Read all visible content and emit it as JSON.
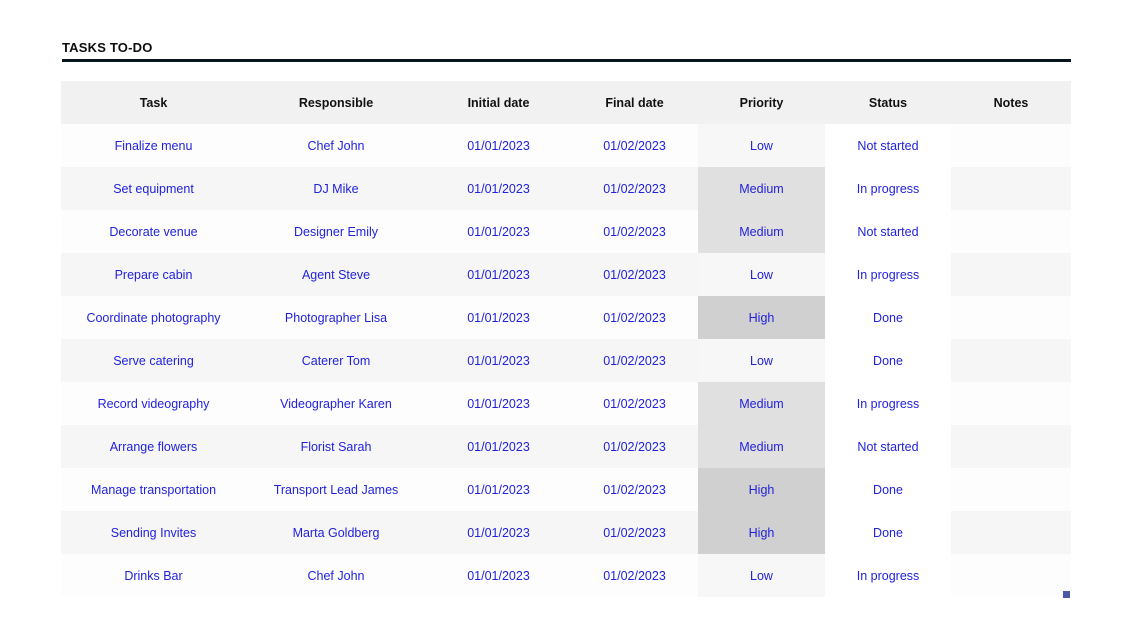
{
  "header": {
    "title": "TASKS TO-DO"
  },
  "colors": {
    "title_text": "#0d0d0d",
    "rule": "#07161d",
    "cell_text": "#2222dd",
    "header_bg": "#f1f1f1",
    "row_odd_bg": "#fdfdfd",
    "row_even_bg": "#f6f6f6",
    "priority_low_bg": "#f7f7f7",
    "priority_medium_bg": "#e0e0e0",
    "priority_high_bg": "#d0d0d0",
    "status_bg": "#ffffff",
    "status_border": "#e3e3e3",
    "resize_handle": "#4a5aa8"
  },
  "table": {
    "columns": [
      "Task",
      "Responsible",
      "Initial date",
      "Final date",
      "Priority",
      "Status",
      "Notes"
    ],
    "rows": [
      {
        "task": "Finalize menu",
        "responsible": "Chef John",
        "initial_date": "01/01/2023",
        "final_date": "01/02/2023",
        "priority": "Low",
        "status": "Not started",
        "notes": ""
      },
      {
        "task": "Set equipment",
        "responsible": "DJ Mike",
        "initial_date": "01/01/2023",
        "final_date": "01/02/2023",
        "priority": "Medium",
        "status": "In progress",
        "notes": ""
      },
      {
        "task": "Decorate venue",
        "responsible": "Designer Emily",
        "initial_date": "01/01/2023",
        "final_date": "01/02/2023",
        "priority": "Medium",
        "status": "Not started",
        "notes": ""
      },
      {
        "task": "Prepare cabin",
        "responsible": "Agent Steve",
        "initial_date": "01/01/2023",
        "final_date": "01/02/2023",
        "priority": "Low",
        "status": "In progress",
        "notes": ""
      },
      {
        "task": "Coordinate photography",
        "responsible": "Photographer Lisa",
        "initial_date": "01/01/2023",
        "final_date": "01/02/2023",
        "priority": "High",
        "status": "Done",
        "notes": ""
      },
      {
        "task": "Serve catering",
        "responsible": "Caterer Tom",
        "initial_date": "01/01/2023",
        "final_date": "01/02/2023",
        "priority": "Low",
        "status": "Done",
        "notes": ""
      },
      {
        "task": "Record videography",
        "responsible": "Videographer Karen",
        "initial_date": "01/01/2023",
        "final_date": "01/02/2023",
        "priority": "Medium",
        "status": "In progress",
        "notes": ""
      },
      {
        "task": "Arrange flowers",
        "responsible": "Florist Sarah",
        "initial_date": "01/01/2023",
        "final_date": "01/02/2023",
        "priority": "Medium",
        "status": "Not started",
        "notes": ""
      },
      {
        "task": "Manage transportation",
        "responsible": "Transport Lead James",
        "initial_date": "01/01/2023",
        "final_date": "01/02/2023",
        "priority": "High",
        "status": "Done",
        "notes": ""
      },
      {
        "task": "Sending Invites",
        "responsible": "Marta Goldberg",
        "initial_date": "01/01/2023",
        "final_date": "01/02/2023",
        "priority": "High",
        "status": "Done",
        "notes": ""
      },
      {
        "task": "Drinks Bar",
        "responsible": "Chef John",
        "initial_date": "01/01/2023",
        "final_date": "01/02/2023",
        "priority": "Low",
        "status": "In progress",
        "notes": ""
      }
    ]
  }
}
